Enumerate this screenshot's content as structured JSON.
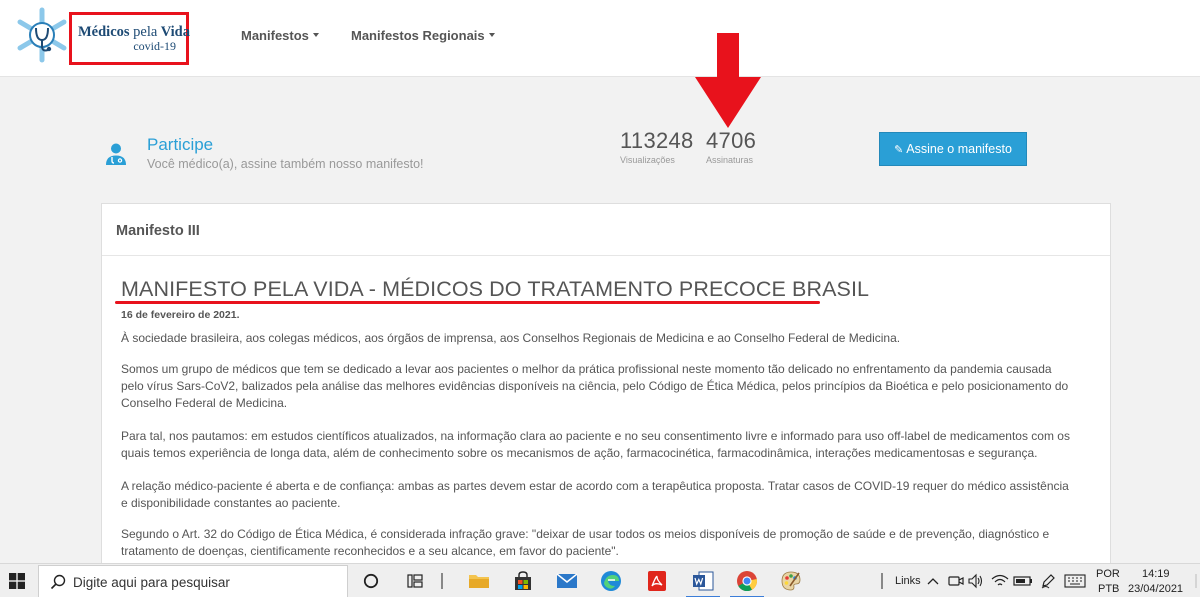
{
  "navbar": {
    "logo": {
      "line1_bold": "Médicos",
      "line1_mid": "pela",
      "line1_end": "Vida",
      "line2": "covid-19"
    },
    "items": [
      {
        "label": "Manifestos"
      },
      {
        "label": "Manifestos Regionais"
      }
    ]
  },
  "participe": {
    "title": "Participe",
    "subtitle": "Você médico(a), assine também nosso manifesto!",
    "stats": [
      {
        "value": "113248",
        "label": "Visualizações"
      },
      {
        "value": "4706",
        "label": "Assinaturas"
      }
    ],
    "button_label": "Assine o manifesto"
  },
  "card": {
    "header": "Manifesto III",
    "title": "MANIFESTO PELA VIDA - MÉDICOS DO TRATAMENTO PRECOCE BRASIL",
    "date": "16 de fevereiro de 2021.",
    "paragraphs": [
      "À sociedade brasileira, aos colegas médicos, aos órgãos de imprensa, aos Conselhos Regionais de Medicina e ao Conselho Federal de Medicina.",
      "Somos um grupo de médicos que tem se dedicado a levar aos pacientes o melhor da prática profissional neste momento tão delicado no enfrentamento da pandemia causada pelo vírus Sars-CoV2, balizados pela análise das melhores evidências disponíveis na ciência, pelo Código de Ética Médica, pelos princípios da Bioética e pelo posicionamento do Conselho Federal de Medicina.",
      "Para tal, nos pautamos: em estudos científicos atualizados, na informação clara ao paciente e no seu consentimento livre e informado para uso off-label de medicamentos com os quais temos experiência de longa data, além de conhecimento sobre os mecanismos de ação, farmacocinética, farmacodinâmica, interações medicamentosas e segurança.",
      "A relação médico-paciente é aberta e de confiança: ambas as partes devem estar de acordo com a terapêutica proposta. Tratar casos de COVID-19 requer do médico assistência e disponibilidade constantes ao paciente.",
      "Segundo o Art. 32 do Código de Ética Médica, é considerada infração grave: \"deixar de usar todos os meios disponíveis de promoção de saúde e de prevenção, diagnóstico e tratamento de doenças, cientificamente reconhecidos e a seu alcance, em favor do paciente\"."
    ]
  },
  "taskbar": {
    "search_placeholder": "Digite aqui para pesquisar",
    "links_label": "Links",
    "lang_line1": "POR",
    "lang_line2": "PTB",
    "time": "14:19",
    "date": "23/04/2021"
  },
  "colors": {
    "accent": "#2a9fd6",
    "annotation_red": "#e8121c",
    "logo_navy": "#1d4a74"
  }
}
